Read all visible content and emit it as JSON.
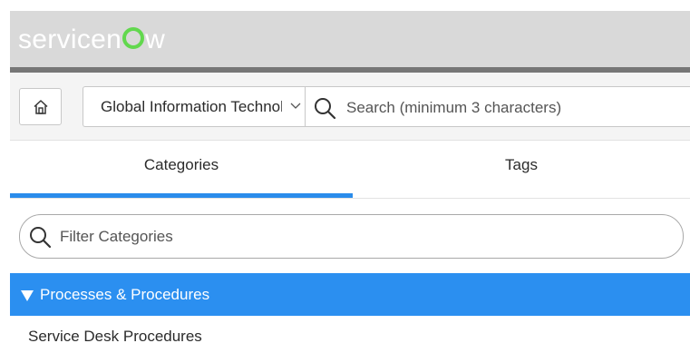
{
  "header": {
    "logo_text_prefix": "servicen",
    "logo_text_suffix": "w",
    "logo_accent": "#62d84e",
    "background": "#d9d9d9"
  },
  "toolbar": {
    "home_icon": "home-icon",
    "knowledge_base_selected": "Global Information Technology",
    "search_placeholder": "Search (minimum 3 characters)",
    "search_value": ""
  },
  "tabs": [
    {
      "label": "Categories",
      "active": true
    },
    {
      "label": "Tags",
      "active": false
    }
  ],
  "filter": {
    "placeholder": "Filter Categories",
    "value": ""
  },
  "categories": {
    "expanded_group": "Processes & Procedures",
    "items": [
      "Service Desk Procedures"
    ]
  },
  "colors": {
    "accent_blue": "#2b8ff0",
    "tab_underline": "#2a8ceb"
  }
}
